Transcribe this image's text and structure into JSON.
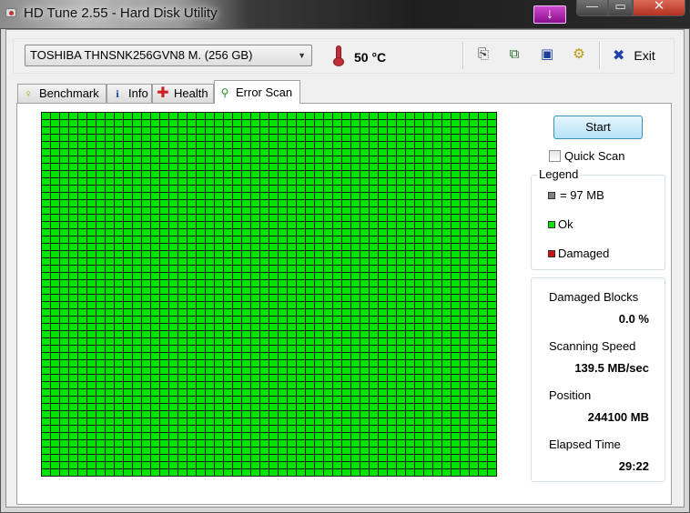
{
  "window": {
    "title": "HD Tune 2.55 - Hard Disk Utility",
    "download_badge": "↓",
    "minimize": "—",
    "maximize": "▭",
    "close": "✕"
  },
  "toolbar": {
    "drive_selected": "TOSHIBA THNSNK256GVN8 M. (256 GB)",
    "drive_arrow": "▼",
    "temperature": "50 °C",
    "icons": {
      "copy_info": "copy-text-icon",
      "copy_screenshot": "copy-screenshot-icon",
      "save": "save-icon",
      "options": "options-icon"
    },
    "exit_label": "Exit",
    "exit_glyph": "✖"
  },
  "tabs": [
    {
      "label": "Benchmark",
      "icon": "lightbulb-icon",
      "glyph": "💡︎",
      "active": false
    },
    {
      "label": "Info",
      "icon": "info-icon",
      "glyph": "i",
      "active": false
    },
    {
      "label": "Health",
      "icon": "health-cross-icon",
      "glyph": "✚",
      "active": false
    },
    {
      "label": "Error Scan",
      "icon": "magnifier-icon",
      "glyph": "🔍︎",
      "active": true
    }
  ],
  "error_scan": {
    "grid": {
      "columns": 50,
      "rows": 50,
      "block_status": "ok"
    },
    "start_label": "Start",
    "quick_scan_label": "Quick Scan",
    "quick_scan_checked": false,
    "legend": {
      "title": "Legend",
      "block_size": "= 97 MB",
      "ok": "Ok",
      "damaged": "Damaged",
      "colors": {
        "block": "#808080",
        "ok": "#00e400",
        "damaged": "#d01010"
      }
    },
    "stats": {
      "damaged_blocks_label": "Damaged Blocks",
      "damaged_blocks_value": "0.0 %",
      "scanning_speed_label": "Scanning Speed",
      "scanning_speed_value": "139.5 MB/sec",
      "position_label": "Position",
      "position_value": "244100 MB",
      "elapsed_time_label": "Elapsed Time",
      "elapsed_time_value": "29:22"
    }
  }
}
